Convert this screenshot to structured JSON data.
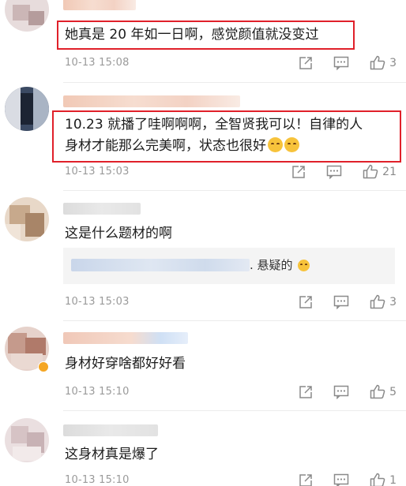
{
  "comments": [
    {
      "text": "她真是 20 年如一日啊，感觉颜值就没变过",
      "time": "10-13 15:08",
      "likes": "3"
    },
    {
      "text_line1": "10.23 就播了哇啊啊啊，全智贤我可以！自律的人",
      "text_line2": "身材才能那么完美啊，状态也很好",
      "time": "10-13 15:03",
      "likes": "21"
    },
    {
      "text": "这是什么题材的啊",
      "reply_suffix": ". 悬疑的",
      "time": "10-13 15:03",
      "likes": "3"
    },
    {
      "text": "身材好穿啥都好好看",
      "time": "10-13 15:10",
      "likes": "5"
    },
    {
      "text": "这身材真是爆了",
      "time": "10-13 15:10",
      "likes": "1"
    }
  ],
  "colors": {
    "highlight": "#e0202a",
    "meta": "#9a9a9a"
  },
  "icons": [
    "share-icon",
    "reply-icon",
    "like-icon",
    "emoji-icon"
  ]
}
